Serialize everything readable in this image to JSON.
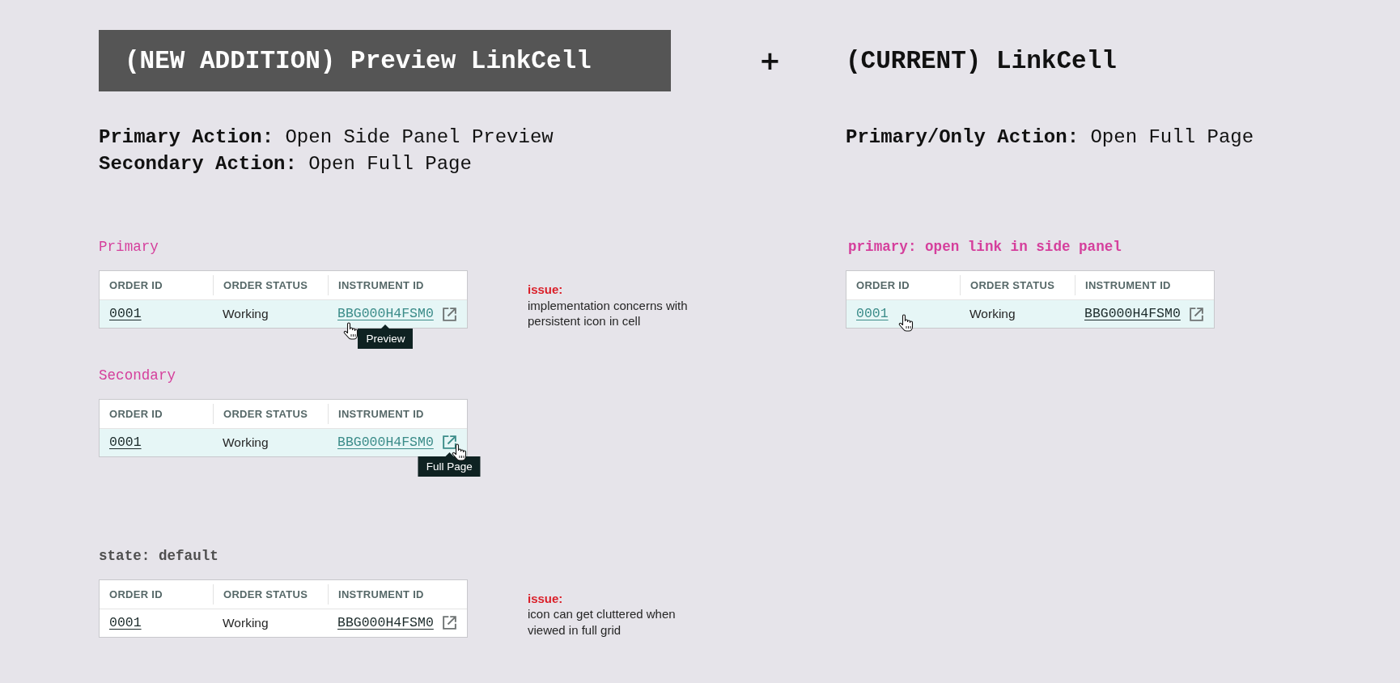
{
  "new_addition": {
    "kind": "banner",
    "title": "(NEW ADDITION) Preview LinkCell",
    "actions": [
      "**Primary Action:** Open Side Panel Preview",
      "**Secondary Action:** Open Full Page"
    ],
    "examples": [
      {
        "label": "Primary",
        "kind": "accent",
        "table": {
          "columns": [
            "ORDER ID",
            "ORDER STATUS",
            "INSTRUMENT ID"
          ],
          "rows": [
            {
              "hovered": true,
              "cells": [
                {
                  "kind": "link",
                  "text": "0001",
                  "highlighted": false,
                  "link_hovered": false
                },
                {
                  "kind": "text",
                  "text": "Working"
                },
                {
                  "kind": "link_icon",
                  "text": "BBG000H4FSM0",
                  "highlighted": true,
                  "link_hovered": true,
                  "icon_highlighted": false,
                  "icon_hovered": false,
                  "tooltip": "Preview"
                }
              ]
            }
          ]
        },
        "note": {
          "label": "issue:",
          "text": "implementation concerns with persistent icon in cell"
        }
      },
      {
        "label": "Secondary",
        "kind": "accent",
        "table": {
          "columns": [
            "ORDER ID",
            "ORDER STATUS",
            "INSTRUMENT ID"
          ],
          "rows": [
            {
              "hovered": true,
              "cells": [
                {
                  "kind": "link",
                  "text": "0001",
                  "highlighted": false,
                  "link_hovered": false
                },
                {
                  "kind": "text",
                  "text": "Working"
                },
                {
                  "kind": "link_icon",
                  "text": "BBG000H4FSM0",
                  "highlighted": true,
                  "link_hovered": false,
                  "icon_highlighted": true,
                  "icon_hovered": true,
                  "tooltip": "Full Page"
                }
              ]
            }
          ]
        }
      },
      {
        "label": "state: default",
        "kind": "state",
        "table": {
          "columns": [
            "ORDER ID",
            "ORDER STATUS",
            "INSTRUMENT ID"
          ],
          "rows": [
            {
              "hovered": false,
              "cells": [
                {
                  "kind": "link",
                  "text": "0001",
                  "highlighted": false,
                  "link_hovered": false
                },
                {
                  "kind": "text",
                  "text": "Working"
                },
                {
                  "kind": "link_icon",
                  "text": "BBG000H4FSM0",
                  "highlighted": false,
                  "link_hovered": false,
                  "icon_highlighted": false,
                  "icon_hovered": false
                }
              ]
            }
          ]
        },
        "note": {
          "label": "issue:",
          "text": "icon can get cluttered when viewed in full grid"
        }
      }
    ]
  },
  "separator": "+",
  "current": {
    "kind": "plain",
    "title": "(CURRENT) LinkCell",
    "actions": [
      "**Primary/Only Action:** Open Full Page"
    ],
    "examples": [
      {
        "label": "primary: open link in side panel",
        "kind": "accent-bold",
        "table": {
          "columns": [
            "ORDER ID",
            "ORDER STATUS",
            "INSTRUMENT ID"
          ],
          "rows": [
            {
              "hovered": true,
              "cells": [
                {
                  "kind": "link",
                  "text": "0001",
                  "highlighted": true,
                  "link_hovered": true
                },
                {
                  "kind": "text",
                  "text": "Working"
                },
                {
                  "kind": "link_icon",
                  "text": "BBG000H4FSM0",
                  "highlighted": false,
                  "link_hovered": false,
                  "icon_highlighted": false,
                  "icon_hovered": false
                }
              ]
            }
          ]
        }
      }
    ]
  }
}
